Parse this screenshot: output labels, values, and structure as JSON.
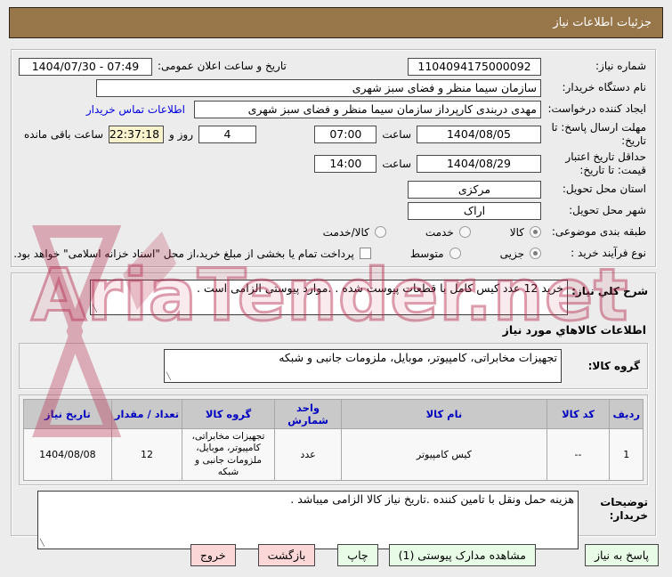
{
  "header": {
    "title": "جزئیات اطلاعات نیاز"
  },
  "form": {
    "need_number": {
      "label": "شماره نیاز:",
      "value": "1104094175000092"
    },
    "announce": {
      "label": "تاریخ و ساعت اعلان عمومی:",
      "value": "1404/07/30 - 07:49"
    },
    "buyer_org": {
      "label": "نام دستگاه خریدار:",
      "value": "سازمان سیما منظر و فضای سبز شهری"
    },
    "creator": {
      "label": "ایجاد کننده درخواست:",
      "value": "مهدی دربندی کارپرداز سازمان سیما منظر و فضای سبز شهری",
      "contact_link": "اطلاعات تماس خریدار"
    },
    "deadline": {
      "label": "مهلت ارسال پاسخ: تا تاریخ:",
      "date": "1404/08/05",
      "time_label": "ساعت",
      "time": "07:00",
      "days": "4",
      "days_label": "روز و",
      "remain_time": "22:37:18",
      "remain_label": "ساعت باقی مانده"
    },
    "price_validity": {
      "label": "حداقل تاریخ اعتبار قیمت: تا تاریخ:",
      "date": "1404/08/29",
      "time_label": "ساعت",
      "time": "14:00"
    },
    "province": {
      "label": "استان محل تحویل:",
      "value": "مرکزی"
    },
    "city": {
      "label": "شهر محل تحویل:",
      "value": "اراک"
    },
    "classification": {
      "label": "طبقه بندی موضوعی:",
      "options": [
        "کالا",
        "خدمت",
        "کالا/خدمت"
      ],
      "selected": 0
    },
    "process_type": {
      "label": "نوع فرآیند خرید :",
      "options": [
        "جزیی",
        "متوسط"
      ],
      "selected": 0,
      "checkbox_label": "پرداخت تمام یا بخشی از مبلغ خرید،از محل \"اسناد خزانه اسلامی\" خواهد بود.",
      "checkbox_checked": false
    }
  },
  "need_desc": {
    "label": "شرح کلي نیاز:",
    "value": "خرید 12 عدد کیس کامل با قطعات پیوست شده . .موارد پیوستی الزامی است ."
  },
  "goods_section": {
    "title": "اطلاعات کالاهاي مورد نیاز",
    "group": {
      "label": "گروه کالا:",
      "value": "تجهیزات مخابراتی، کامپیوتر، موبایل، ملزومات جانبی و شبکه"
    },
    "table": {
      "headers": [
        "ردیف",
        "کد کالا",
        "نام کالا",
        "واحد شمارش",
        "گروه کالا",
        "تعداد / مقدار",
        "تاریخ نیاز"
      ],
      "rows": [
        [
          "1",
          "--",
          "کیس کامپیوتر",
          "عدد",
          "تجهیزات مخابراتی، کامپیوتر، موبایل، ملزومات جانبی و شبکه",
          "12",
          "1404/08/08"
        ]
      ]
    }
  },
  "buyer_notes": {
    "label": "توضیحات خریدار:",
    "value": "هزینه حمل ونقل با تامین کننده .تاریخ نیاز کالا الزامی میباشد ."
  },
  "buttons": [
    {
      "label": "پاسخ به نیاز",
      "style": "green"
    },
    {
      "label": "مشاهده مدارک پیوستی (1)",
      "style": "green"
    },
    {
      "label": "چاپ",
      "style": "green"
    },
    {
      "label": "بازگشت",
      "style": "pink"
    },
    {
      "label": "خروج",
      "style": "pink"
    }
  ],
  "watermark": {
    "text": "AriaTender.net"
  },
  "colors": {
    "titlebar": "#97764a",
    "link": "#0000dd",
    "remaining_bg": "#f8f3cd",
    "button_green": "#e7fbe7",
    "button_pink": "#fcd7d7",
    "table_header_text": "#0000c0",
    "watermark": "#b52f50"
  }
}
